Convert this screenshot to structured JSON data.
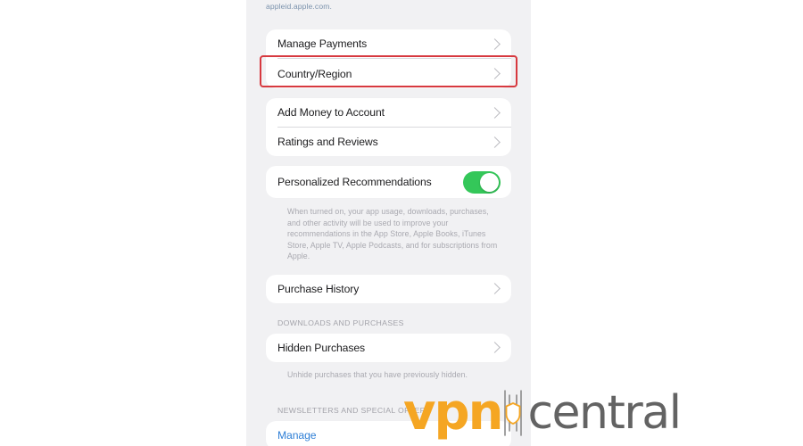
{
  "page": {
    "background_color": "#ffffff",
    "screen_background": "#f1f1f3"
  },
  "screen": {
    "top_note": "appleid.apple.com.",
    "account_card": {
      "rows": [
        {
          "label": "Manage Payments",
          "accessory": "chevron-right-icon"
        },
        {
          "label": "Country/Region",
          "accessory": "chevron-right-icon"
        }
      ]
    },
    "purchases_card": {
      "rows": [
        {
          "label": "Add Money to Account",
          "accessory": "chevron-right-icon"
        },
        {
          "label": "Ratings and Reviews",
          "accessory": "chevron-right-icon"
        }
      ]
    },
    "recommendations_card": {
      "label": "Personalized Recommendations",
      "toggle_state": "on",
      "toggle_color": "#34c759"
    },
    "recommendations_footnote": "When turned on, your app usage, downloads, purchases, and other activity will be used to improve your recommendations in the App Store, Apple Books, iTunes Store, Apple TV, Apple Podcasts, and for subscriptions from Apple.",
    "history_card": {
      "rows": [
        {
          "label": "Purchase History",
          "accessory": "chevron-right-icon"
        }
      ]
    },
    "downloads_section": {
      "header": "DOWNLOADS AND PURCHASES",
      "rows": [
        {
          "label": "Hidden Purchases",
          "accessory": "chevron-right-icon"
        }
      ],
      "footnote": "Unhide purchases that you have previously hidden."
    },
    "newsletters_section": {
      "header": "NEWSLETTERS AND SPECIAL OFFERS",
      "rows": [
        {
          "label": "Manage"
        }
      ]
    }
  },
  "annotation": {
    "highlight": {
      "target": "Country/Region",
      "color": "#d7393f"
    }
  },
  "watermark": {
    "brand_primary": "vpn",
    "brand_secondary": "central",
    "primary_color": "#f5a623",
    "secondary_color": "#636363"
  }
}
